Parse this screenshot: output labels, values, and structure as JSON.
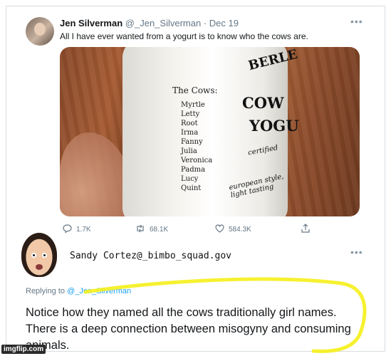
{
  "first_tweet": {
    "display_name": "Jen Silverman",
    "handle_date": "@_Jen_Silverman · Dec 19",
    "text": "All I have ever wanted from a yogurt is to know who the cows are.",
    "more_label": "•••",
    "media": {
      "cows_title": "The Cows:",
      "cow_names": [
        "Myrtle",
        "Letty",
        "Root",
        "Irma",
        "Fanny",
        "Julia",
        "Veronica",
        "Padma",
        "Lucy",
        "Quint"
      ],
      "brand_lines": [
        "BERLE",
        "COW",
        "YOGU",
        "certified",
        "european style, light tasting"
      ]
    },
    "actions": {
      "reply_count": "1.7K",
      "retweet_count": "68.1K",
      "like_count": "584.3K"
    }
  },
  "overlay_caption": "Sandy Cortez@_bimbo_squad.gov",
  "second_tweet": {
    "more_label": "•••",
    "replying_prefix": "Replying to",
    "replying_handle": "@_Jen_Silverman",
    "text": "Notice how they named all the cows traditionally girl names. There is a deep connection between misogyny and consuming animals."
  },
  "watermark": "imgflip.com",
  "colors": {
    "highlight": "#f5ef1a",
    "link": "#1da1f2",
    "muted": "#657786"
  }
}
